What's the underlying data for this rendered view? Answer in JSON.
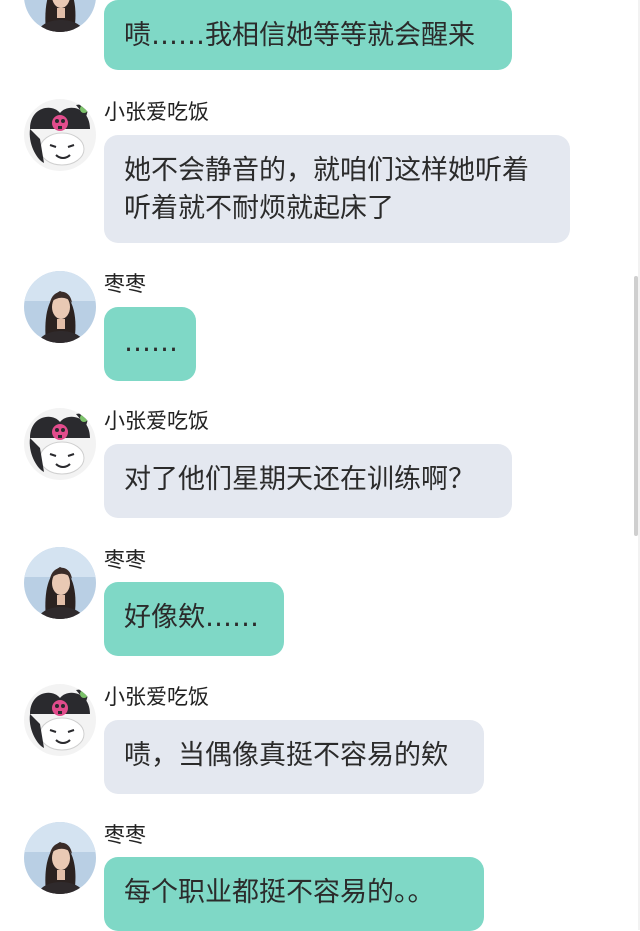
{
  "messages": [
    {
      "sender": "",
      "text": "啧……我相信她等等就会醒来",
      "side": "self-teal",
      "avatar": "woman-portrait-avatar"
    },
    {
      "sender": "小张爱吃饭",
      "text": "她不会静音的，就咱们这样她听着听着就不耐烦就起床了",
      "side": "gray",
      "avatar": "kuromi-avatar"
    },
    {
      "sender": "枣枣",
      "text": "……",
      "side": "teal",
      "avatar": "woman-portrait-avatar"
    },
    {
      "sender": "小张爱吃饭",
      "text": "对了他们星期天还在训练啊？",
      "side": "gray",
      "avatar": "kuromi-avatar"
    },
    {
      "sender": "枣枣",
      "text": "好像欸……",
      "side": "teal",
      "avatar": "woman-portrait-avatar"
    },
    {
      "sender": "小张爱吃饭",
      "text": "啧，当偶像真挺不容易的欸",
      "side": "gray",
      "avatar": "kuromi-avatar"
    },
    {
      "sender": "枣枣",
      "text": "每个职业都挺不容易的。。",
      "side": "teal",
      "avatar": "woman-portrait-avatar"
    }
  ],
  "colors": {
    "teal_bubble": "#7fd8c6",
    "gray_bubble": "#e4e8f0",
    "background": "#ffffff"
  }
}
